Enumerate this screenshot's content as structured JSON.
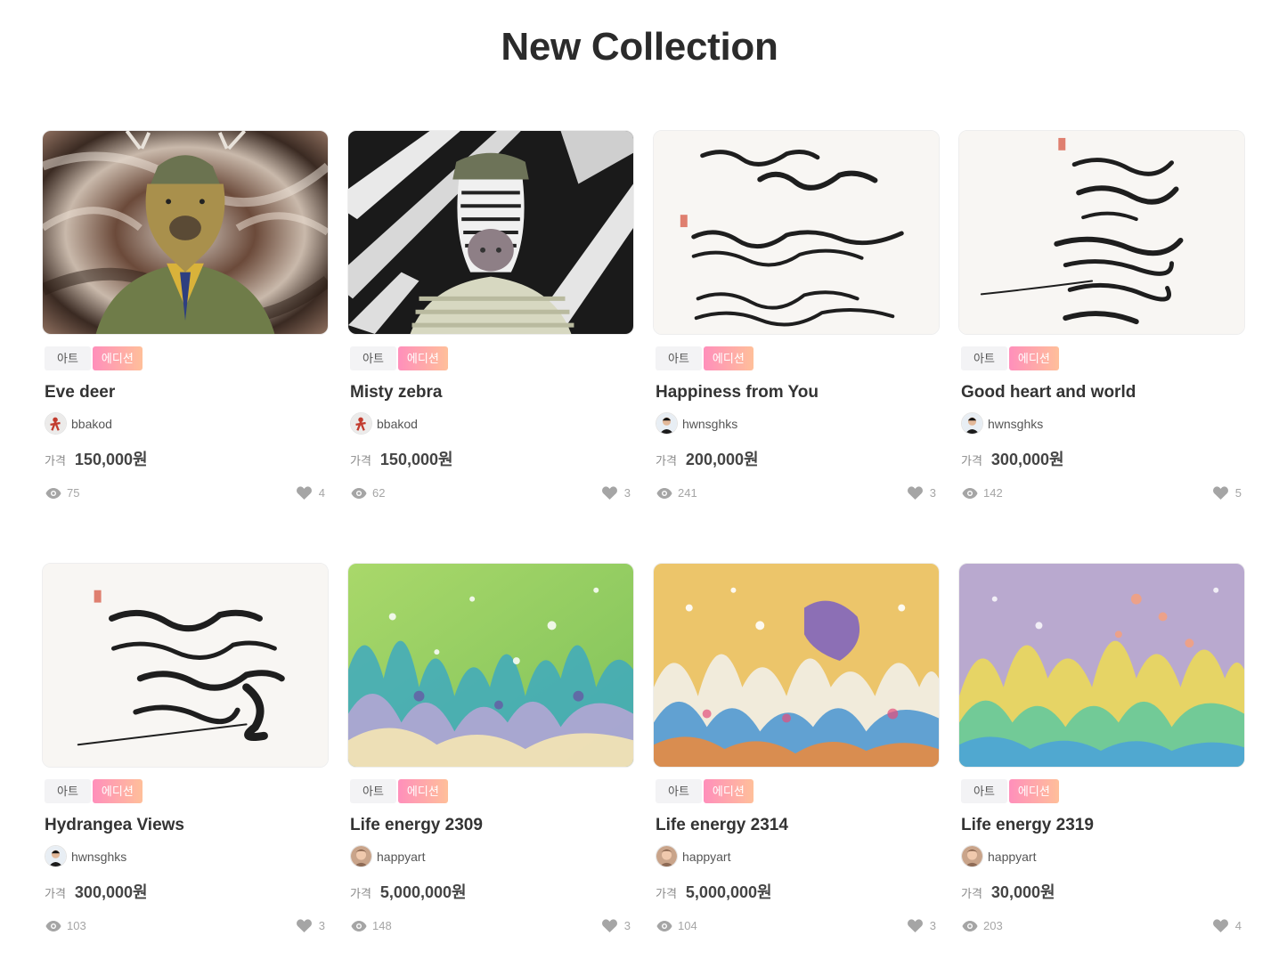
{
  "page": {
    "title": "New Collection"
  },
  "labels": {
    "price": "가격"
  },
  "items": [
    {
      "thumbnail_icon": "deer-portrait-image",
      "tag_type": "아트",
      "tag_edition": "에디션",
      "title": "Eve deer",
      "artist": "bbakod",
      "avatar_icon": "red-figure-avatar",
      "price": "150,000원",
      "views": "75",
      "likes": "4"
    },
    {
      "thumbnail_icon": "zebra-portrait-image",
      "tag_type": "아트",
      "tag_edition": "에디션",
      "title": "Misty zebra",
      "artist": "bbakod",
      "avatar_icon": "red-figure-avatar",
      "price": "150,000원",
      "views": "62",
      "likes": "3"
    },
    {
      "thumbnail_icon": "calligraphy-image",
      "tag_type": "아트",
      "tag_edition": "에디션",
      "title": "Happiness from You",
      "artist": "hwnsghks",
      "avatar_icon": "person-avatar",
      "price": "200,000원",
      "views": "241",
      "likes": "3"
    },
    {
      "thumbnail_icon": "calligraphy-image",
      "tag_type": "아트",
      "tag_edition": "에디션",
      "title": "Good heart and world",
      "artist": "hwnsghks",
      "avatar_icon": "person-avatar",
      "price": "300,000원",
      "views": "142",
      "likes": "5"
    },
    {
      "thumbnail_icon": "calligraphy-image",
      "tag_type": "아트",
      "tag_edition": "에디션",
      "title": "Hydrangea Views",
      "artist": "hwnsghks",
      "avatar_icon": "person-avatar",
      "price": "300,000원",
      "views": "103",
      "likes": "3"
    },
    {
      "thumbnail_icon": "abstract-splash-image",
      "tag_type": "아트",
      "tag_edition": "에디션",
      "title": "Life energy 2309",
      "artist": "happyart",
      "avatar_icon": "portrait-avatar",
      "price": "5,000,000원",
      "views": "148",
      "likes": "3"
    },
    {
      "thumbnail_icon": "abstract-splash-image",
      "tag_type": "아트",
      "tag_edition": "에디션",
      "title": "Life energy 2314",
      "artist": "happyart",
      "avatar_icon": "portrait-avatar",
      "price": "5,000,000원",
      "views": "104",
      "likes": "3"
    },
    {
      "thumbnail_icon": "abstract-splash-image",
      "tag_type": "아트",
      "tag_edition": "에디션",
      "title": "Life energy 2319",
      "artist": "happyart",
      "avatar_icon": "portrait-avatar",
      "price": "30,000원",
      "views": "203",
      "likes": "4"
    }
  ],
  "colors": {
    "edition_gradient_start": "#ff8fbb",
    "edition_gradient_end": "#ffbf9a",
    "tag_art_bg": "#f3f3f5",
    "icon_gray": "#a5a5a5"
  }
}
